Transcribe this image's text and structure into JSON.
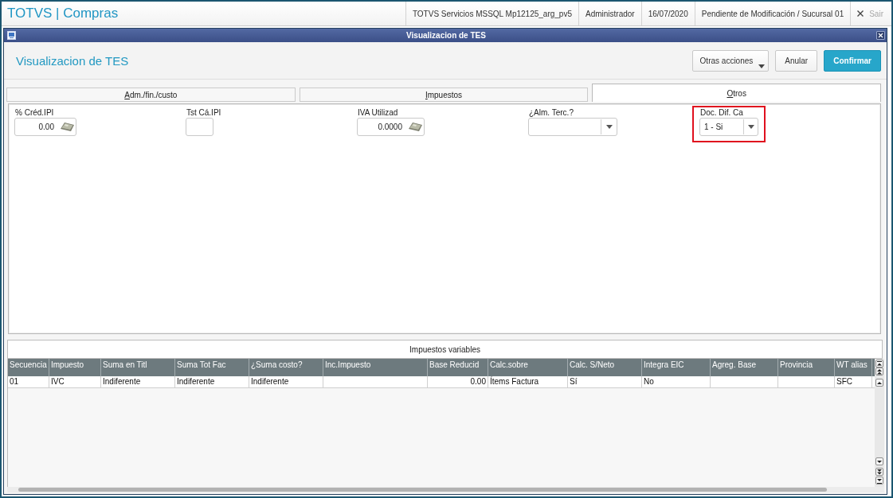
{
  "app_bar": {
    "brand": "TOTVS | Compras",
    "info": [
      "TOTVS Servicios MSSQL Mp12125_arg_pv5",
      "Administrador",
      "16/07/2020",
      "Pendiente de Modificación / Sucursal 01"
    ],
    "exit": {
      "label": "Sair",
      "disabled": true
    }
  },
  "dialog": {
    "title": "Visualizacion de TES",
    "heading": "Visualizacion de TES",
    "actions": [
      {
        "label": "Otras acciones",
        "kind": "menu"
      },
      {
        "label": "Anular",
        "kind": "default"
      },
      {
        "label": "Confirmar",
        "kind": "primary"
      }
    ]
  },
  "tabs": [
    {
      "label": "Adm./fin./custo",
      "selected": false
    },
    {
      "label": "Impuestos",
      "selected": false
    },
    {
      "label": "Otros",
      "selected": true
    }
  ],
  "fields": [
    {
      "label": "% Créd.IPI",
      "kind": "calc",
      "value": "0.00",
      "highlighted": false
    },
    {
      "label": "Tst Cá.IPI",
      "kind": "text",
      "highlighted": false
    },
    {
      "label": "IVA Utilizad",
      "kind": "calc",
      "value": "0.0000",
      "highlighted": false
    },
    {
      "label": "¿Alm. Terc.?",
      "kind": "select",
      "highlighted": false
    },
    {
      "label": "Doc. Dif. Ca",
      "kind": "select",
      "value": "1 - Si",
      "highlighted": true
    }
  ],
  "grid": {
    "title": "Impuestos variables",
    "columns": [
      {
        "label": "Secuencia",
        "kind": "text"
      },
      {
        "label": "Impuesto",
        "kind": "text"
      },
      {
        "label": "Suma en Titl",
        "kind": "text"
      },
      {
        "label": "Suma Tot Fac",
        "kind": "text"
      },
      {
        "label": "¿Suma costo?",
        "kind": "text"
      },
      {
        "label": "Inc.Impuesto",
        "kind": "text"
      },
      {
        "label": "Base Reducid",
        "kind": "number"
      },
      {
        "label": "Calc.sobre",
        "kind": "text"
      },
      {
        "label": "Calc. S/Neto",
        "kind": "text"
      },
      {
        "label": "Integra EIC",
        "kind": "text"
      },
      {
        "label": "Agreg. Base",
        "kind": "text"
      },
      {
        "label": "Provincia",
        "kind": "text"
      },
      {
        "label": "WT alias",
        "kind": "text"
      }
    ],
    "rows": [
      {
        "cells": [
          "01",
          "IVC",
          "Indiferente",
          "Indiferente",
          "Indiferente",
          null,
          "0.00",
          "Ítems Factura",
          "Sí",
          "No",
          null,
          null,
          "SFC"
        ]
      }
    ]
  }
}
